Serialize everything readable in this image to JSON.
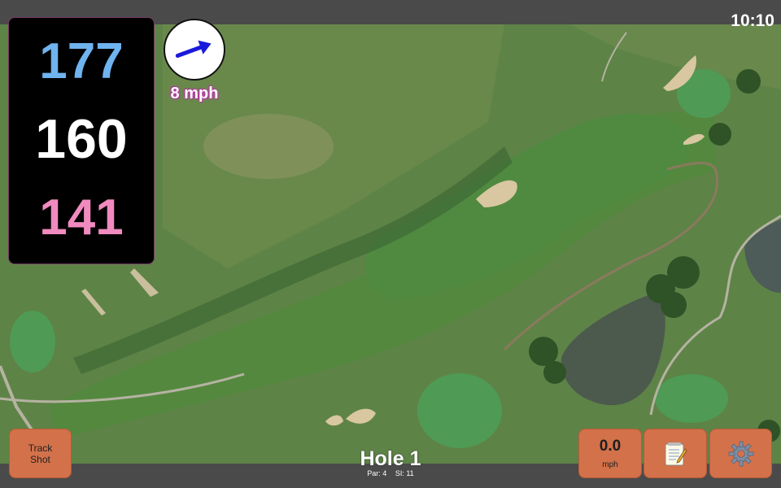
{
  "status": {
    "time": "10:10"
  },
  "distances": {
    "back": "177",
    "middle": "160",
    "front": "141"
  },
  "wind": {
    "speed": "8 mph",
    "icon": "wind-direction-arrow-icon",
    "direction": "east-northeast"
  },
  "hole": {
    "title": "Hole 1",
    "par": "Par: 4",
    "stroke_index": "SI: 11"
  },
  "buttons": {
    "track_shot": {
      "line1": "Track",
      "line2": "Shot"
    },
    "speed": {
      "value": "0.0",
      "unit": "mph"
    },
    "notes": {
      "icon": "notepad-icon"
    },
    "settings": {
      "icon": "gear-icon"
    }
  },
  "colors": {
    "back_distance": "#6fb3ef",
    "middle_distance": "#ffffff",
    "front_distance": "#f08abf",
    "button": "#d2714a",
    "wind_arrow": "#1a1adb"
  }
}
